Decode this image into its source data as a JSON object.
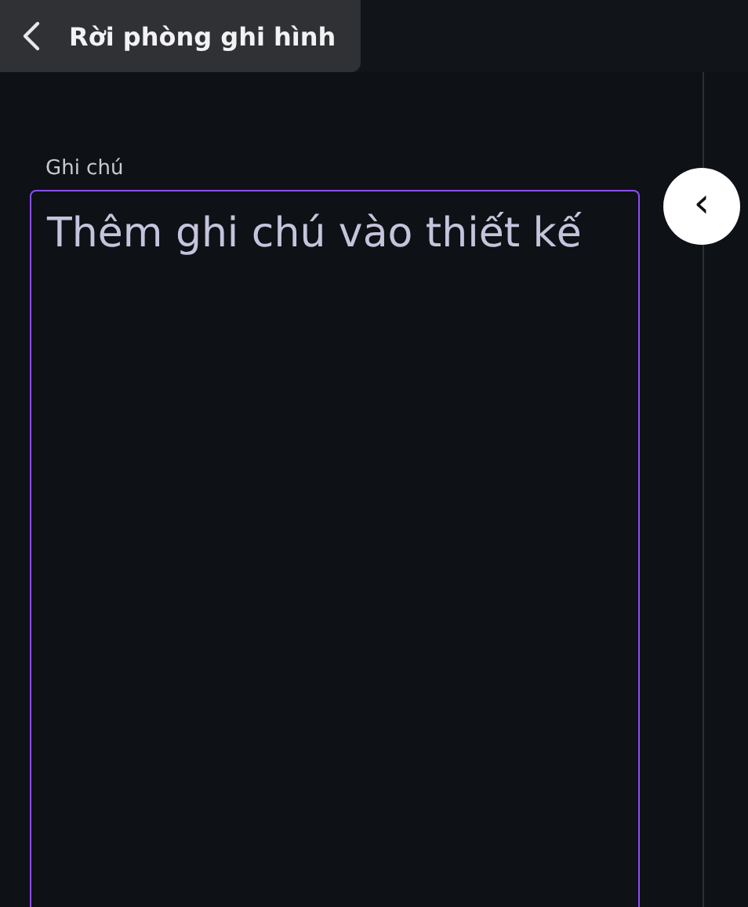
{
  "top_bar": {
    "back_button": {
      "label": "Rời phòng ghi hình"
    }
  },
  "notes": {
    "label": "Ghi chú",
    "placeholder": "Thêm ghi chú vào thiết kế"
  },
  "side_panel": {
    "collapse_button": {
      "icon": "‹"
    }
  }
}
